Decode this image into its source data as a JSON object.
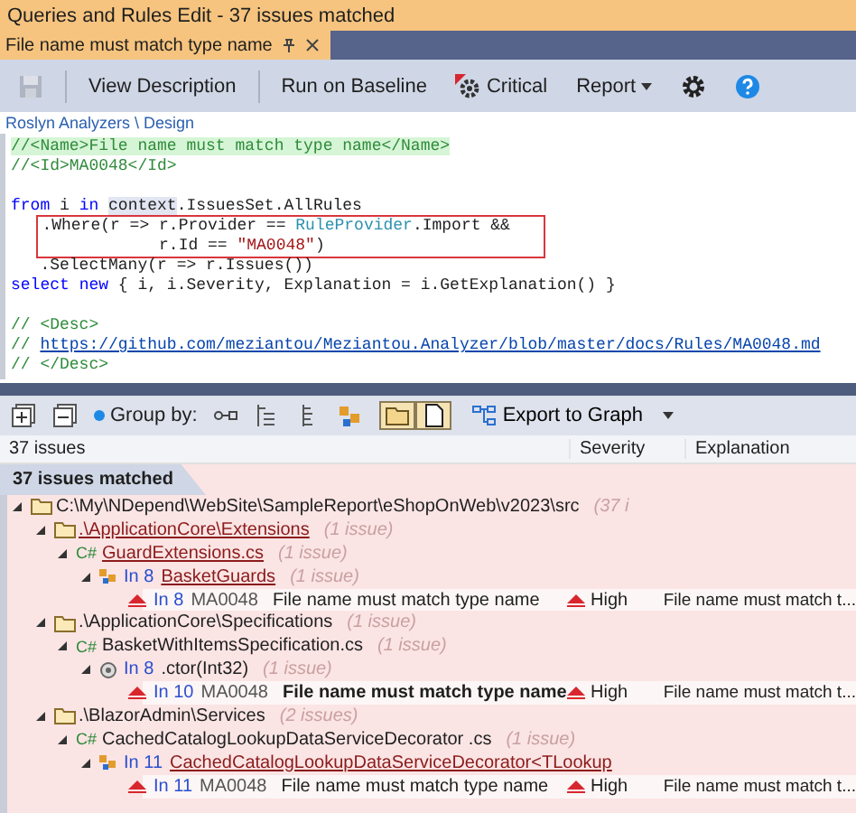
{
  "window": {
    "title": "Queries and Rules Edit  - 37 issues matched"
  },
  "document_tab": {
    "label": "File name must match type name",
    "selected": true
  },
  "toolbar": [
    {
      "kind": "save",
      "disabled": true
    },
    {
      "kind": "separator"
    },
    {
      "kind": "button",
      "label": "View Description"
    },
    {
      "kind": "separator"
    },
    {
      "kind": "button",
      "label": "Run on Baseline"
    },
    {
      "kind": "critical",
      "label": "Critical"
    },
    {
      "kind": "dropdown",
      "label": "Report"
    },
    {
      "kind": "settings"
    },
    {
      "kind": "help"
    }
  ],
  "breadcrumb": "Roslyn Analyzers \\ Design",
  "code": [
    {
      "kind": "code",
      "highlighted": true,
      "tokens": [
        {
          "kind": "comment",
          "text": "//<Name>File name must match type name</Name>"
        }
      ]
    },
    {
      "kind": "code",
      "tokens": [
        {
          "kind": "comment",
          "text": "//<Id>MA0048</Id>"
        }
      ]
    },
    {
      "kind": "blank"
    },
    {
      "kind": "code",
      "tokens": [
        {
          "kind": "keyword",
          "text": "from"
        },
        {
          "kind": "plain",
          "text": " i "
        },
        {
          "kind": "keyword",
          "text": "in "
        },
        {
          "kind": "marked",
          "text": "context"
        },
        {
          "kind": "plain",
          "text": ".IssuesSet.AllRules"
        }
      ]
    },
    {
      "kind": "code",
      "boxed": true,
      "tokens": [
        {
          "kind": "plain",
          "text": "   .Where(r => r.Provider == "
        },
        {
          "kind": "type",
          "text": "RuleProvider"
        },
        {
          "kind": "plain",
          "text": ".Import &&"
        }
      ]
    },
    {
      "kind": "code",
      "boxed": true,
      "tokens": [
        {
          "kind": "plain",
          "text": "               r.Id == "
        },
        {
          "kind": "string",
          "text": "\"MA0048\""
        },
        {
          "kind": "plain",
          "text": ")"
        }
      ]
    },
    {
      "kind": "code",
      "tokens": [
        {
          "kind": "plain",
          "text": "   .SelectMany(r => r.Issues())"
        }
      ]
    },
    {
      "kind": "code",
      "tokens": [
        {
          "kind": "keyword",
          "text": "select "
        },
        {
          "kind": "keyword",
          "text": "new"
        },
        {
          "kind": "plain",
          "text": " { i, i.Severity, Explanation = i.GetExplanation() }"
        }
      ]
    },
    {
      "kind": "blank"
    },
    {
      "kind": "code",
      "tokens": [
        {
          "kind": "comment",
          "text": "// <Desc>"
        }
      ]
    },
    {
      "kind": "code",
      "tokens": [
        {
          "kind": "comment",
          "text": "// "
        },
        {
          "kind": "link",
          "text": "https://github.com/meziantou/Meziantou.Analyzer/blob/master/docs/Rules/MA0048.md"
        }
      ]
    },
    {
      "kind": "code",
      "tokens": [
        {
          "kind": "comment",
          "text": "// </Desc>"
        }
      ]
    }
  ],
  "results_toolbar": [
    {
      "kind": "expand-all"
    },
    {
      "kind": "collapse-all"
    },
    {
      "kind": "label",
      "label": "Group by:"
    },
    {
      "kind": "group-a"
    },
    {
      "kind": "group-b"
    },
    {
      "kind": "group-c"
    },
    {
      "kind": "group-d"
    },
    {
      "kind": "toggle-folder",
      "selected": true
    },
    {
      "kind": "toggle-file",
      "selected": true
    },
    {
      "kind": "export",
      "label": "Export to Graph"
    },
    {
      "kind": "caret"
    }
  ],
  "columns": [
    "37 issues",
    "Severity",
    "Explanation"
  ],
  "results_tab": {
    "label": "37 issues matched",
    "selected": true
  },
  "tree": [
    {
      "kind": "folder",
      "label": "C:\\My\\NDepend\\WebSite\\SampleReport\\eShopOnWeb\\v2023\\src",
      "count": "(37 i",
      "linked": false,
      "expanded": true,
      "children": [
        {
          "kind": "folder",
          "label": ".\\ApplicationCore\\Extensions",
          "count": "(1 issue)",
          "linked": true,
          "expanded": true,
          "children": [
            {
              "kind": "file",
              "lang": "C#",
              "label": "GuardExtensions.cs",
              "count": "(1 issue)",
              "linked": true,
              "expanded": true,
              "children": [
                {
                  "kind": "type",
                  "line": "In 8",
                  "label": "BasketGuards",
                  "count": "(1 issue)",
                  "linked": true,
                  "expanded": true,
                  "children": [
                    {
                      "kind": "issue",
                      "line": "In 8",
                      "rule": "MA0048",
                      "label": "File name must match type name",
                      "bold": false,
                      "severity": "High",
                      "explanation": "File name must match t..."
                    }
                  ]
                }
              ]
            }
          ]
        },
        {
          "kind": "folder",
          "label": ".\\ApplicationCore\\Specifications",
          "count": "(1 issue)",
          "linked": false,
          "expanded": true,
          "children": [
            {
              "kind": "file",
              "lang": "C#",
              "label": "BasketWithItemsSpecification.cs",
              "count": "(1 issue)",
              "linked": false,
              "expanded": true,
              "children": [
                {
                  "kind": "method",
                  "line": "In 8",
                  "label": ".ctor(Int32)",
                  "count": "(1 issue)",
                  "linked": false,
                  "expanded": true,
                  "children": [
                    {
                      "kind": "issue",
                      "line": "In 10",
                      "rule": "MA0048",
                      "label": "File name must match type name",
                      "bold": true,
                      "severity": "High",
                      "explanation": "File name must match t..."
                    }
                  ]
                }
              ]
            }
          ]
        },
        {
          "kind": "folder",
          "label": ".\\BlazorAdmin\\Services",
          "count": "(2 issues)",
          "linked": false,
          "expanded": true,
          "children": [
            {
              "kind": "file",
              "lang": "C#",
              "label": "CachedCatalogLookupDataServiceDecorator .cs",
              "count": "(1 issue)",
              "linked": false,
              "expanded": true,
              "children": [
                {
                  "kind": "type",
                  "line": "In 11",
                  "label": "CachedCatalogLookupDataServiceDecorator<TLookup",
                  "linked": true,
                  "expanded": true,
                  "children": [
                    {
                      "kind": "issue",
                      "line": "In 11",
                      "rule": "MA0048",
                      "label": "File name must match type name",
                      "bold": false,
                      "severity": "High",
                      "explanation": "File name must match t..."
                    }
                  ]
                }
              ]
            }
          ]
        }
      ]
    }
  ]
}
